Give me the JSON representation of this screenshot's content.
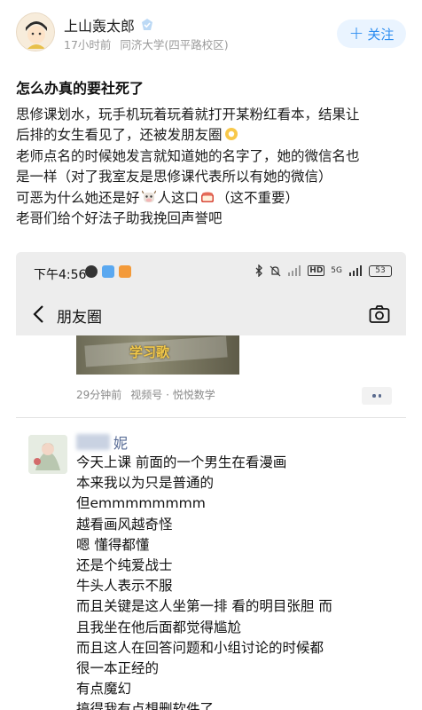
{
  "post": {
    "username": "上山轰太郎",
    "time": "17小时前",
    "school": "同济大学(四平路校区)",
    "follow_label": "关注",
    "title": "怎么办真的要社死了",
    "lines": [
      "思修课划水，玩手机玩着玩着就打开某粉红看本，结果让",
      "后排的女生看见了，还被发朋友圈",
      "老师点名的时候她发言就知道她的名字了，她的微信名也",
      "是一样（对了我室友是思修课代表所以有她的微信）",
      "可恶为什么她还是好",
      "人这口",
      "（这不重要）",
      "老哥们给个好法子助我挽回声誉吧"
    ]
  },
  "embed": {
    "status_time": "下午4:56",
    "battery": "53",
    "network": "5G",
    "nav_title": "朋友圈",
    "video": {
      "caption": "学习歌",
      "time_ago": "29分钟前",
      "source": "视频号 · 悦悦数学"
    },
    "moment": {
      "name_suffix": "妮",
      "lines": [
        "今天上课 前面的一个男生在看漫画",
        "本来我以为只是普通的",
        "但emmmmmmmm",
        "越看画风越奇怪",
        "嗯 懂得都懂",
        "还是个纯爱战士",
        "牛头人表示不服",
        "而且关键是这人坐第一排 看的明目张胆 而",
        "且我坐在他后面都觉得尴尬",
        "而且这人在回答问题和小组讨论的时候都",
        "很一本正经的",
        "有点魔幻",
        "搞得我有点想删软件了"
      ]
    }
  },
  "icons": {
    "verified": "verified-badge-icon",
    "emoji_1": "ok-hand-emoji-icon",
    "emoji_2": "cow-emoji-icon",
    "emoji_3": "bento-box-emoji-icon"
  },
  "colors": {
    "accent_blue": "#2c8df0",
    "wechat_name": "#576b95",
    "follow_bg": "#eaf4ff"
  }
}
